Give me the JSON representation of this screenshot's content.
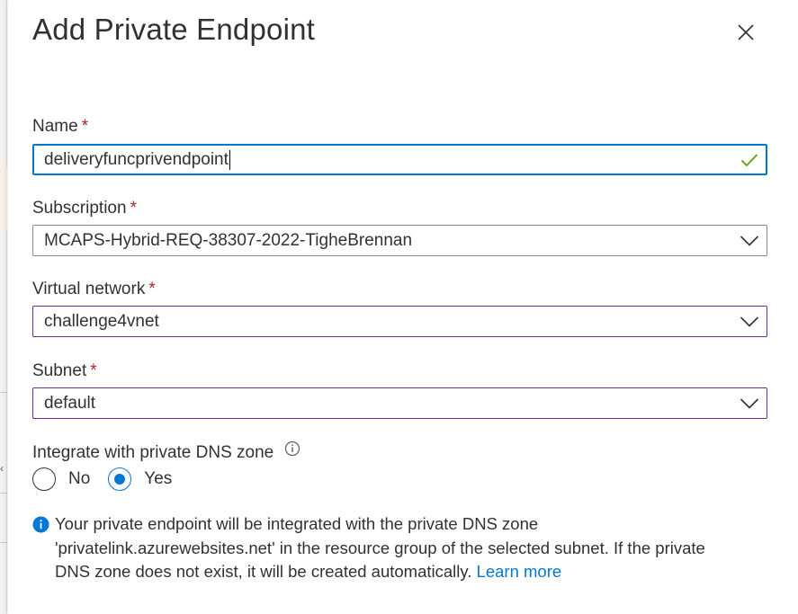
{
  "panel": {
    "title": "Add Private Endpoint"
  },
  "form": {
    "name": {
      "label": "Name",
      "required_marker": "*",
      "value": "deliveryfuncprivendpoint"
    },
    "subscription": {
      "label": "Subscription",
      "required_marker": "*",
      "value": "MCAPS-Hybrid-REQ-38307-2022-TigheBrennan"
    },
    "virtual_network": {
      "label": "Virtual network",
      "required_marker": "*",
      "value": "challenge4vnet"
    },
    "subnet": {
      "label": "Subnet",
      "required_marker": "*",
      "value": "default"
    },
    "dns": {
      "label": "Integrate with private DNS zone",
      "options": [
        {
          "label": "No",
          "selected": false
        },
        {
          "label": "Yes",
          "selected": true
        }
      ]
    },
    "info": {
      "line1": "Your private endpoint will be integrated with the private DNS zone",
      "line2": "'privatelink.azurewebsites.net' in the resource group of the selected subnet. If the private",
      "line3": "DNS zone does not exist, it will be created automatically.",
      "link": "Learn more"
    }
  },
  "icons": {
    "close": "close-icon",
    "valid": "checkmark-icon",
    "dropdown": "chevron-down-icon",
    "info": "info-icon",
    "tooltip": "info-circle-outline-icon"
  },
  "colors": {
    "accent": "#0078d4",
    "required": "#a4262c",
    "valid": "#57a300",
    "dropdown_border": "#6b2c91"
  }
}
